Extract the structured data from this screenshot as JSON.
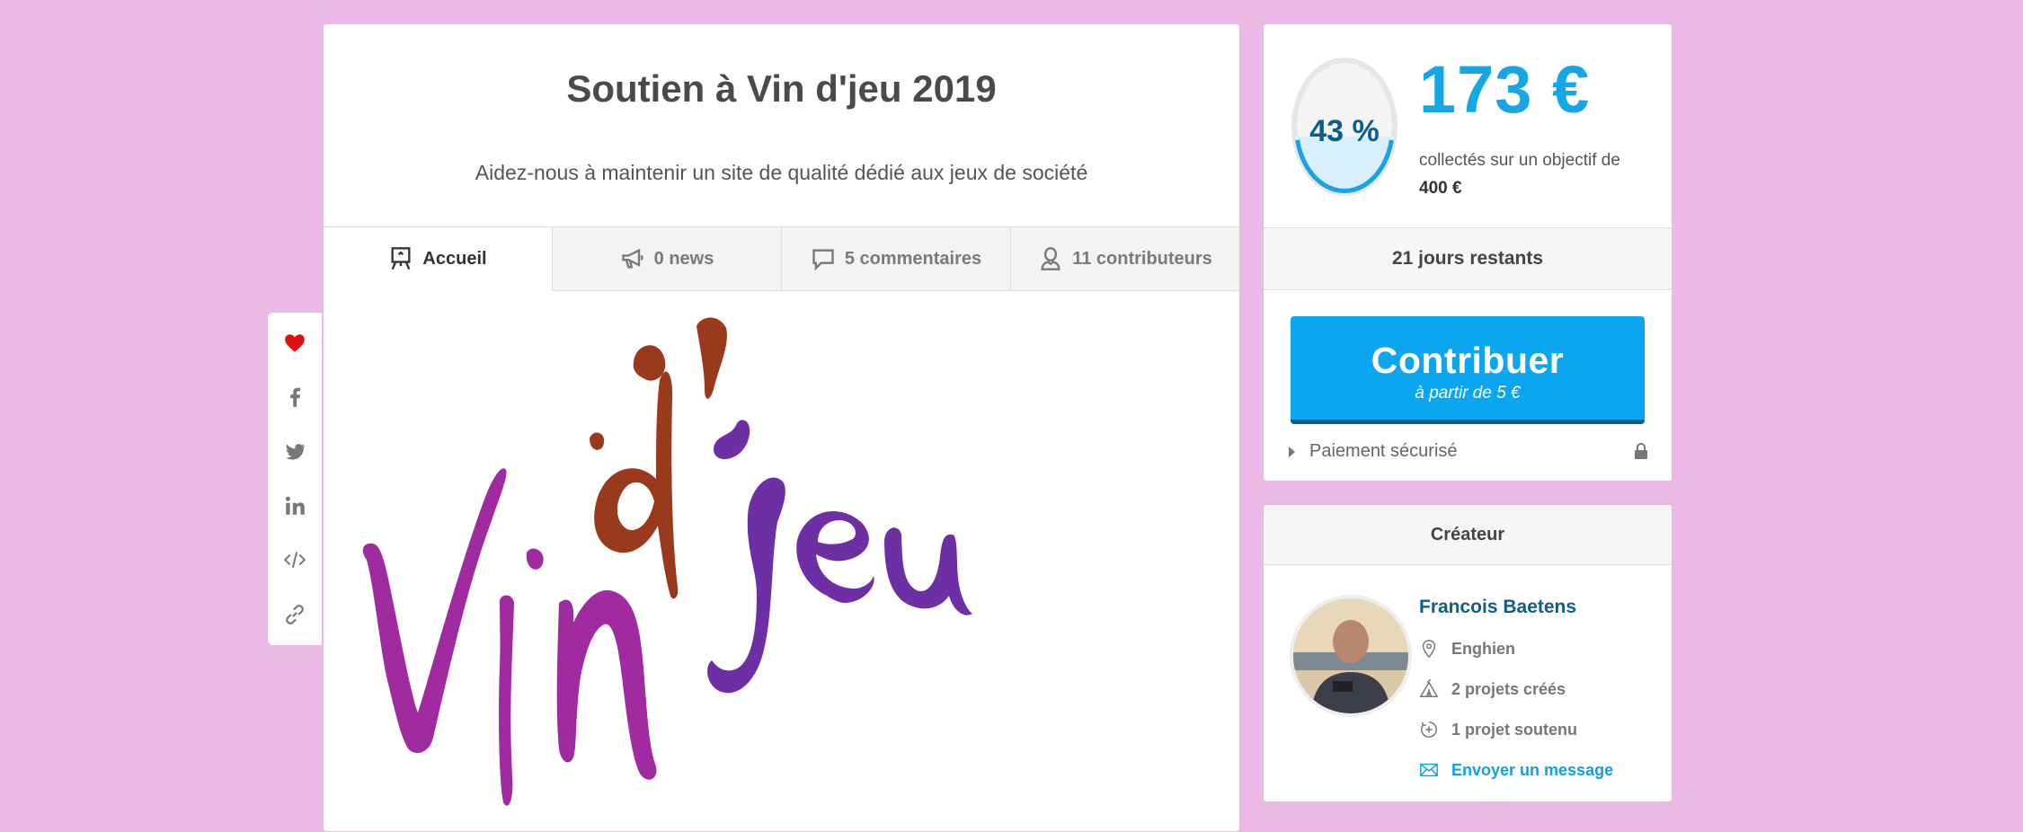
{
  "project": {
    "title": "Soutien à Vin d'jeu 2019",
    "subtitle": "Aidez-nous à maintenir un site de qualité dédié aux jeux de société"
  },
  "tabs": [
    {
      "label": "Accueil",
      "icon": "easel-icon",
      "active": true
    },
    {
      "label": "0 news",
      "icon": "megaphone-icon",
      "active": false
    },
    {
      "label": "5 commentaires",
      "icon": "comment-icon",
      "active": false
    },
    {
      "label": "11 contributeurs",
      "icon": "user-icon",
      "active": false
    }
  ],
  "hero_logo": {
    "parts": [
      "Vin",
      "d'",
      "jeu"
    ],
    "colors": {
      "vin": "#a02aa0",
      "d": "#9a3a1c",
      "jeu": "#6d2fa3"
    }
  },
  "share": {
    "icons": [
      "heart-icon",
      "facebook-icon",
      "twitter-icon",
      "linkedin-icon",
      "embed-icon",
      "link-icon"
    ],
    "heart_color": "#e01010"
  },
  "funding": {
    "percent_label": "43 %",
    "percent": 0.43,
    "amount": "173 €",
    "goal_text": "collectés sur un objectif de",
    "goal_amount": "400 €",
    "days_left": "21 jours restants",
    "contribute_label": "Contribuer",
    "contribute_min": "à partir de 5 €",
    "secure_label": "Paiement sécurisé",
    "accent": "#0ba6ef"
  },
  "creator": {
    "header": "Créateur",
    "name": "Francois Baetens",
    "location": "Enghien",
    "projects_created": "2 projets créés",
    "projects_supported": "1 projet soutenu",
    "message_link": "Envoyer un message"
  }
}
